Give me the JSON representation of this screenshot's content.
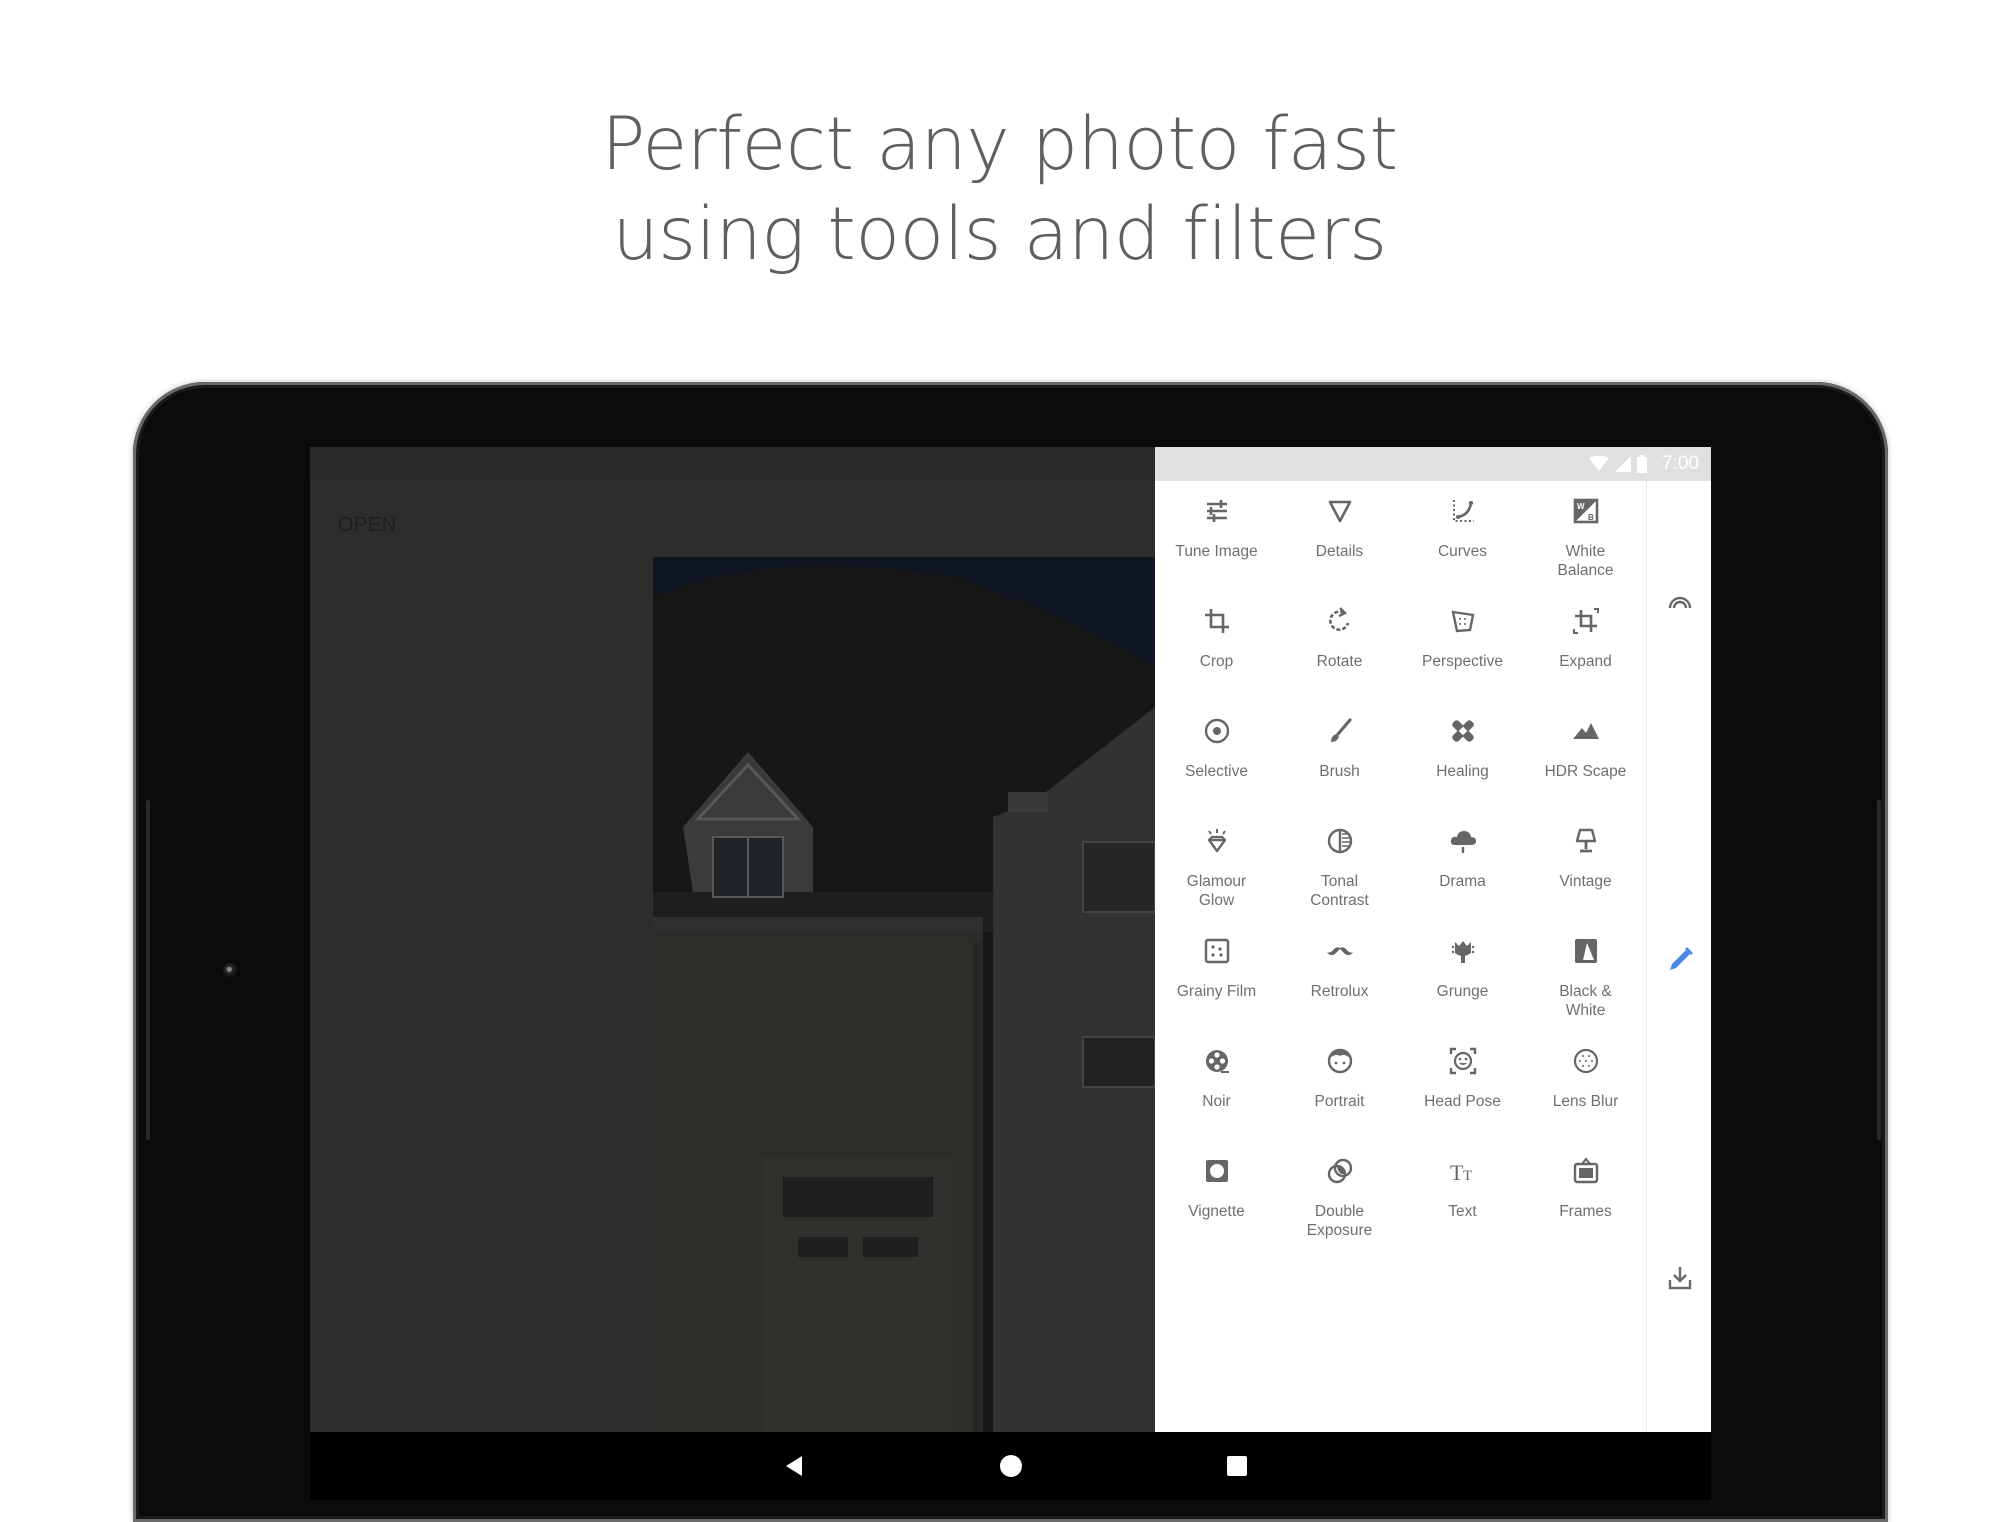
{
  "headline": {
    "line1": "Perfect any photo fast",
    "line2": "using tools and filters"
  },
  "editor": {
    "open_label": "OPEN"
  },
  "status_bar": {
    "time": "7:00",
    "icons": [
      "wifi-icon",
      "signal-icon",
      "battery-icon"
    ]
  },
  "tools": [
    {
      "label": "Tune Image",
      "icon": "tune-icon"
    },
    {
      "label": "Details",
      "icon": "details-triangle-icon"
    },
    {
      "label": "Curves",
      "icon": "curves-icon"
    },
    {
      "label": "White\nBalance",
      "icon": "white-balance-icon"
    },
    {
      "label": "Crop",
      "icon": "crop-icon"
    },
    {
      "label": "Rotate",
      "icon": "rotate-icon"
    },
    {
      "label": "Perspective",
      "icon": "perspective-icon"
    },
    {
      "label": "Expand",
      "icon": "expand-icon"
    },
    {
      "label": "Selective",
      "icon": "selective-icon"
    },
    {
      "label": "Brush",
      "icon": "brush-icon"
    },
    {
      "label": "Healing",
      "icon": "healing-icon"
    },
    {
      "label": "HDR Scape",
      "icon": "hdr-mountains-icon"
    },
    {
      "label": "Glamour\nGlow",
      "icon": "glamour-glow-icon"
    },
    {
      "label": "Tonal\nContrast",
      "icon": "tonal-contrast-icon"
    },
    {
      "label": "Drama",
      "icon": "drama-cloud-icon"
    },
    {
      "label": "Vintage",
      "icon": "vintage-lamp-icon"
    },
    {
      "label": "Grainy Film",
      "icon": "grainy-film-icon"
    },
    {
      "label": "Retrolux",
      "icon": "mustache-icon"
    },
    {
      "label": "Grunge",
      "icon": "grunge-icon"
    },
    {
      "label": "Black &\nWhite",
      "icon": "black-white-icon"
    },
    {
      "label": "Noir",
      "icon": "film-reel-icon"
    },
    {
      "label": "Portrait",
      "icon": "portrait-face-icon"
    },
    {
      "label": "Head Pose",
      "icon": "head-pose-icon"
    },
    {
      "label": "Lens Blur",
      "icon": "lens-blur-icon"
    },
    {
      "label": "Vignette",
      "icon": "vignette-icon"
    },
    {
      "label": "Double\nExposure",
      "icon": "double-exposure-icon"
    },
    {
      "label": "Text",
      "icon": "text-icon"
    },
    {
      "label": "Frames",
      "icon": "frames-icon"
    }
  ],
  "rail": {
    "items": [
      "styles-arc-icon",
      "edit-pencil-icon",
      "export-download-icon"
    ],
    "active": "edit-pencil-icon"
  },
  "colors": {
    "accent": "#4a86e8",
    "icon": "#666666",
    "label": "#6f6f6f",
    "headline": "#5f5f5f"
  },
  "nav": [
    "back-icon",
    "home-icon",
    "recents-icon"
  ]
}
